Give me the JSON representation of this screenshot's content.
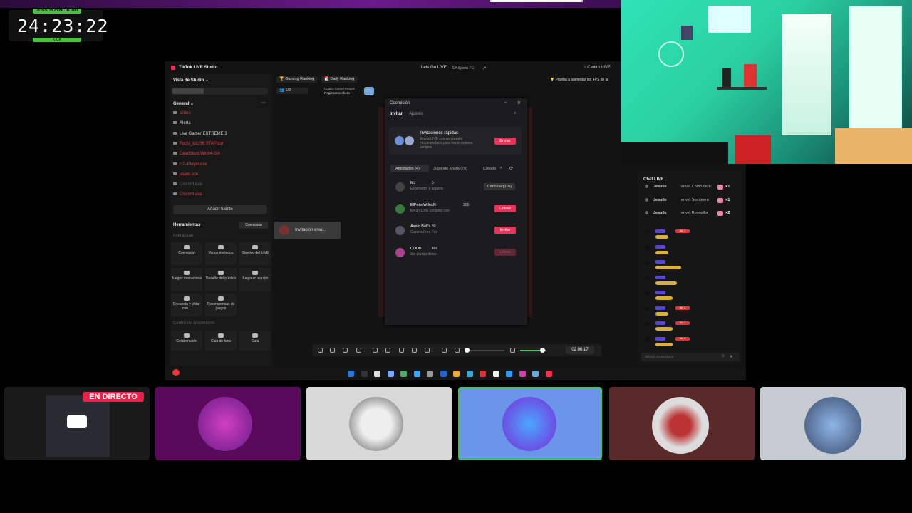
{
  "timer": {
    "name_tag": "JOSSURZVHCRDNO",
    "time": "24:23:22",
    "sub_tag": "KICK"
  },
  "studio": {
    "title": "TikTok LIVE Studio",
    "stream_title": "Lets Go LIVE!",
    "game": "EA Sports FC",
    "centro": "Centro LIVE",
    "fps_tip": "Prueba a aumentar los FPS de la",
    "view_label": "Vista de Studio",
    "general": "General",
    "sources": [
      {
        "label": "Vídeo",
        "style": "red"
      },
      {
        "label": "Alerta",
        "style": "normal"
      },
      {
        "label": "Live Gamer EXTREME 3",
        "style": "normal"
      },
      {
        "label": "FocM_b3256.STAPtico",
        "style": "red"
      },
      {
        "label": "Deadblant.Win64-Shi",
        "style": "red"
      },
      {
        "label": "HD-Player.exe",
        "style": "red"
      },
      {
        "label": "javaw.exe",
        "style": "red"
      },
      {
        "label": "Discord.exe",
        "style": "dim"
      },
      {
        "label": "Discord.exe",
        "style": "red"
      }
    ],
    "add_source": "Añadir fuente",
    "tools_header": "Herramientas",
    "tools_badge": "Coemisión",
    "interact": "Interactuar",
    "tools": [
      {
        "label": "Coemisión"
      },
      {
        "label": "Varios invitados"
      },
      {
        "label": "Objetivo del LIVE"
      },
      {
        "label": "Juegos interactivos"
      },
      {
        "label": "Desafío del público"
      },
      {
        "label": "Juego en equipo"
      },
      {
        "label": "Encuesta y Votar con..."
      },
      {
        "label": "Recompensas de juegos"
      }
    ],
    "growth": "Centro de crecimiento",
    "growth_tools": [
      {
        "label": "Colaboración"
      },
      {
        "label": "Club de fans"
      },
      {
        "label": "Guía"
      }
    ],
    "gaming_ranking": "Gaming Ranking",
    "daily_ranking": "Daily Ranking",
    "viewers": "1/2",
    "creator_line1": "Cuatro Camel Progra",
    "creator_line2": "Registrarse ahora",
    "invite_toast": "Invitación envi..."
  },
  "dialog": {
    "title": "Coemisión",
    "tab_invite": "Invitar",
    "tab_settings": "Ajustes",
    "quick_title": "Invitaciones rápidas",
    "quick_desc": "Envía LIVE con un creador recomendado para hacer nuevos amigos",
    "send": "Enviar",
    "filter_friends": "Amistades (4)",
    "filter_playing": "Jugando ahora (70)",
    "filter_creators": "Creado",
    "rows": [
      {
        "name": "MJ",
        "count": "5",
        "status": "Esperando a alguien",
        "action": "Cancelar(10s)",
        "kind": "grey"
      },
      {
        "name": "ElPeterWifesN",
        "count": "206",
        "status": "En un LIVE conjunto con",
        "action": "Unirse",
        "kind": "red"
      },
      {
        "name": "Axelo Bell's",
        "count": "80",
        "status": "Garena Free Fire",
        "action": "Invitar",
        "kind": "red"
      },
      {
        "name": "CDDB",
        "count": "466",
        "status": "Sin plazas libres",
        "action": "Unirse",
        "kind": "disabled"
      }
    ]
  },
  "chat": {
    "title": "Chat LIVE",
    "messages": [
      {
        "user": "Jesulle",
        "text": "envió Como de tc",
        "mult": "×1"
      },
      {
        "user": "Jesulle",
        "text": "envió Sombrero",
        "mult": "×1"
      },
      {
        "user": "Jesulle",
        "text": "envió Rosquilla",
        "mult": "×2"
      }
    ],
    "input_placeholder": "Añadir comentario",
    "top_label": "LIVE",
    "level": "No. 3"
  },
  "controls": {
    "time": "02:00:17"
  },
  "tiles": {
    "live_badge": "EN DIRECTO"
  },
  "colors": {
    "accent": "#e8335a",
    "highlight_tile_border": "#39c94a",
    "chat_highlight": "#5a42d8"
  }
}
